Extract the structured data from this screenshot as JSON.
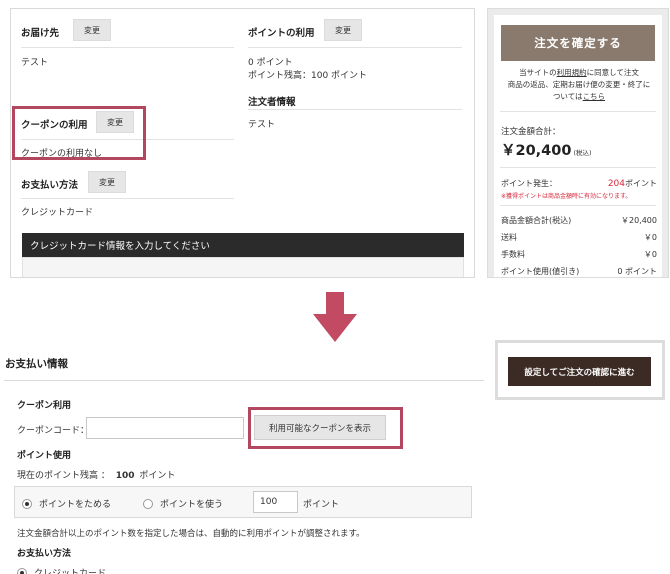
{
  "top": {
    "delivery": {
      "title": "お届け先",
      "change": "変更",
      "value": "テスト"
    },
    "points": {
      "title": "ポイントの利用",
      "change": "変更",
      "value": "0 ポイント",
      "balance": "ポイント残高：100 ポイント"
    },
    "orderer": {
      "title": "注文者情報",
      "value": "テスト"
    },
    "coupon": {
      "title": "クーポンの利用",
      "change": "変更",
      "value": "クーポンの利用なし"
    },
    "payment": {
      "title": "お支払い方法",
      "change": "変更",
      "value": "クレジットカード"
    },
    "cc_bar": "クレジットカード情報を入力してください"
  },
  "sidebar": {
    "confirm_button": "注文を確定する",
    "note_line1": "当サイトの",
    "note_link1": "利用規約",
    "note_line1b": "に同意して注文",
    "note_line2": "商品の返品、定期お届け便の変更・終了に",
    "note_line3": "ついては",
    "note_link2": "こちら",
    "total_label": "注文金額合計：",
    "total_value": "￥20,400",
    "total_suffix": "(税込)",
    "points_label": "ポイント発生：",
    "points_value": "204",
    "points_unit": "ポイント",
    "points_note": "※獲得ポイントは商品金額時に有効になります。",
    "rows": [
      {
        "label": "商品金額合計(税込)",
        "value": "￥20,400"
      },
      {
        "label": "送料",
        "value": "￥0"
      },
      {
        "label": "手数料",
        "value": "￥0"
      },
      {
        "label": "ポイント使用(値引き)",
        "value": "0 ポイント"
      }
    ],
    "colors": {
      "confirm_bg": "#8a7a6d",
      "points_red": "#d8273a"
    }
  },
  "bottom": {
    "title": "お支払い情報",
    "coupon_section": "クーポン利用",
    "coupon_code_label": "クーポンコード：",
    "coupon_code_value": "",
    "show_coupon_button": "利用可能なクーポンを表示",
    "point_section": "ポイント使用",
    "point_balance_label": "現在のポイント残高 ：",
    "point_balance_value": "100",
    "point_balance_unit": "ポイント",
    "radio_save": "ポイントをためる",
    "radio_use": "ポイントを使う",
    "point_input_value": "100",
    "point_input_unit": "ポイント",
    "point_note": "注文金額合計以上のポイント数を指定した場合は、自動的に利用ポイントが調整されます。",
    "payment_section": "お支払い方法",
    "payment_option": "クレジットカード",
    "next_button": "設定してご注文の確認に進む"
  },
  "highlight_color": "#b3475f",
  "arrow_icon": "arrow-down-icon"
}
